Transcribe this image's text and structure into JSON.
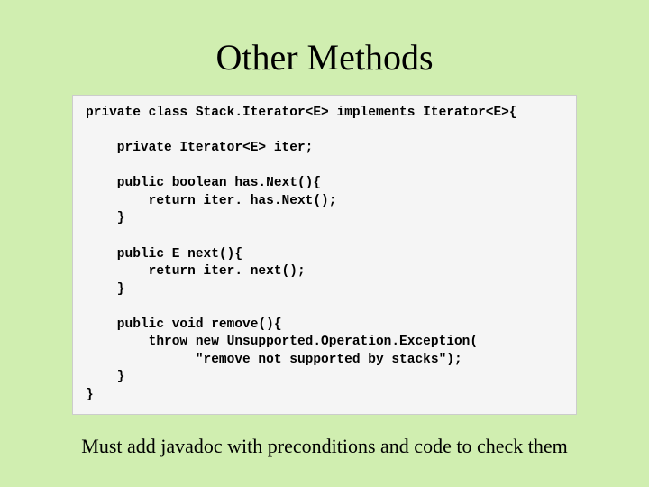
{
  "slide": {
    "title": "Other Methods",
    "code": "private class Stack.Iterator<E> implements Iterator<E>{\n\n    private Iterator<E> iter;\n\n    public boolean has.Next(){\n        return iter. has.Next();\n    }\n\n    public E next(){\n        return iter. next();\n    }\n\n    public void remove(){\n        throw new Unsupported.Operation.Exception(\n              \"remove not supported by stacks\");\n    }\n}",
    "footnote": "Must add javadoc with preconditions and code to check them"
  }
}
